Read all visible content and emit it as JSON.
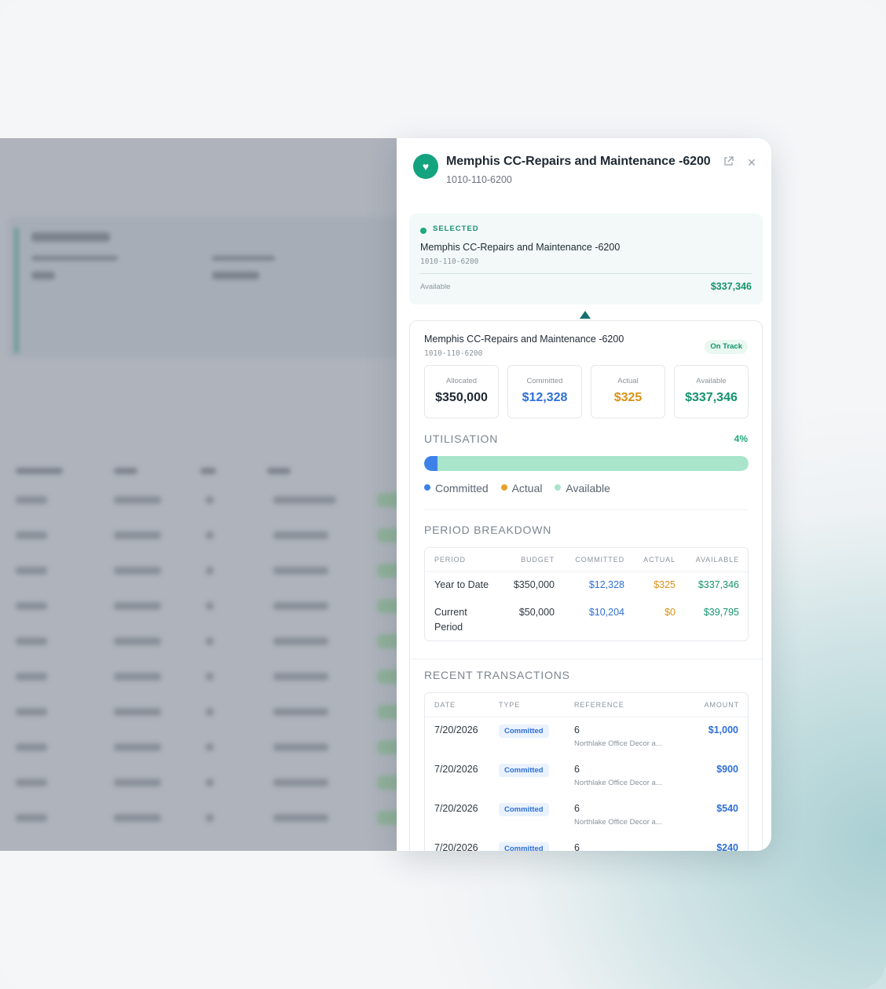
{
  "header": {
    "title": "Memphis CC-Repairs and Maintenance -6200",
    "code": "1010-110-6200",
    "logo_icon": "heart-icon",
    "external_icon": "external-link-icon",
    "close_icon": "close-icon"
  },
  "selected": {
    "label": "SELECTED",
    "title": "Memphis CC-Repairs and Maintenance -6200",
    "code": "1010-110-6200",
    "available_label": "Available",
    "available_value": "$337,346"
  },
  "detail": {
    "title": "Memphis CC-Repairs and Maintenance -6200",
    "code": "1010-110-6200",
    "status": "On Track",
    "stats": [
      {
        "label": "Allocated",
        "value": "$350,000",
        "color": "#1f2933"
      },
      {
        "label": "Committed",
        "value": "$12,328",
        "color": "#2f6fd6"
      },
      {
        "label": "Actual",
        "value": "$325",
        "color": "#d99215"
      },
      {
        "label": "Available",
        "value": "$337,346",
        "color": "#15936b"
      }
    ],
    "utilisation": {
      "heading": "UTILISATION",
      "percent_label": "4%",
      "percent": 4,
      "legend": [
        "Committed",
        "Actual",
        "Available"
      ],
      "colors": {
        "committed": "#3c82e8",
        "actual": "#e8a22a",
        "available": "#a8e5cb"
      }
    },
    "period_breakdown": {
      "heading": "PERIOD BREAKDOWN",
      "columns": [
        "PERIOD",
        "BUDGET",
        "COMMITTED",
        "ACTUAL",
        "AVAILABLE"
      ],
      "rows": [
        {
          "period": "Year to Date",
          "budget": "$350,000",
          "committed": "$12,328",
          "actual": "$325",
          "available": "$337,346"
        },
        {
          "period_line1": "Current",
          "period_line2": "Period",
          "budget": "$50,000",
          "committed": "$10,204",
          "actual": "$0",
          "available": "$39,795"
        }
      ]
    },
    "recent_transactions": {
      "heading": "RECENT TRANSACTIONS",
      "columns": [
        "DATE",
        "TYPE",
        "REFERENCE",
        "AMOUNT"
      ],
      "rows": [
        {
          "date": "7/20/2026",
          "type": "Committed",
          "ref": "6",
          "ref_sub": "Northlake Office Decor a...",
          "amount": "$1,000"
        },
        {
          "date": "7/20/2026",
          "type": "Committed",
          "ref": "6",
          "ref_sub": "Northlake Office Decor a...",
          "amount": "$900"
        },
        {
          "date": "7/20/2026",
          "type": "Committed",
          "ref": "6",
          "ref_sub": "Northlake Office Decor a...",
          "amount": "$540"
        },
        {
          "date": "7/20/2026",
          "type": "Committed",
          "ref": "6",
          "ref_sub": "",
          "amount": "$240"
        }
      ]
    }
  }
}
